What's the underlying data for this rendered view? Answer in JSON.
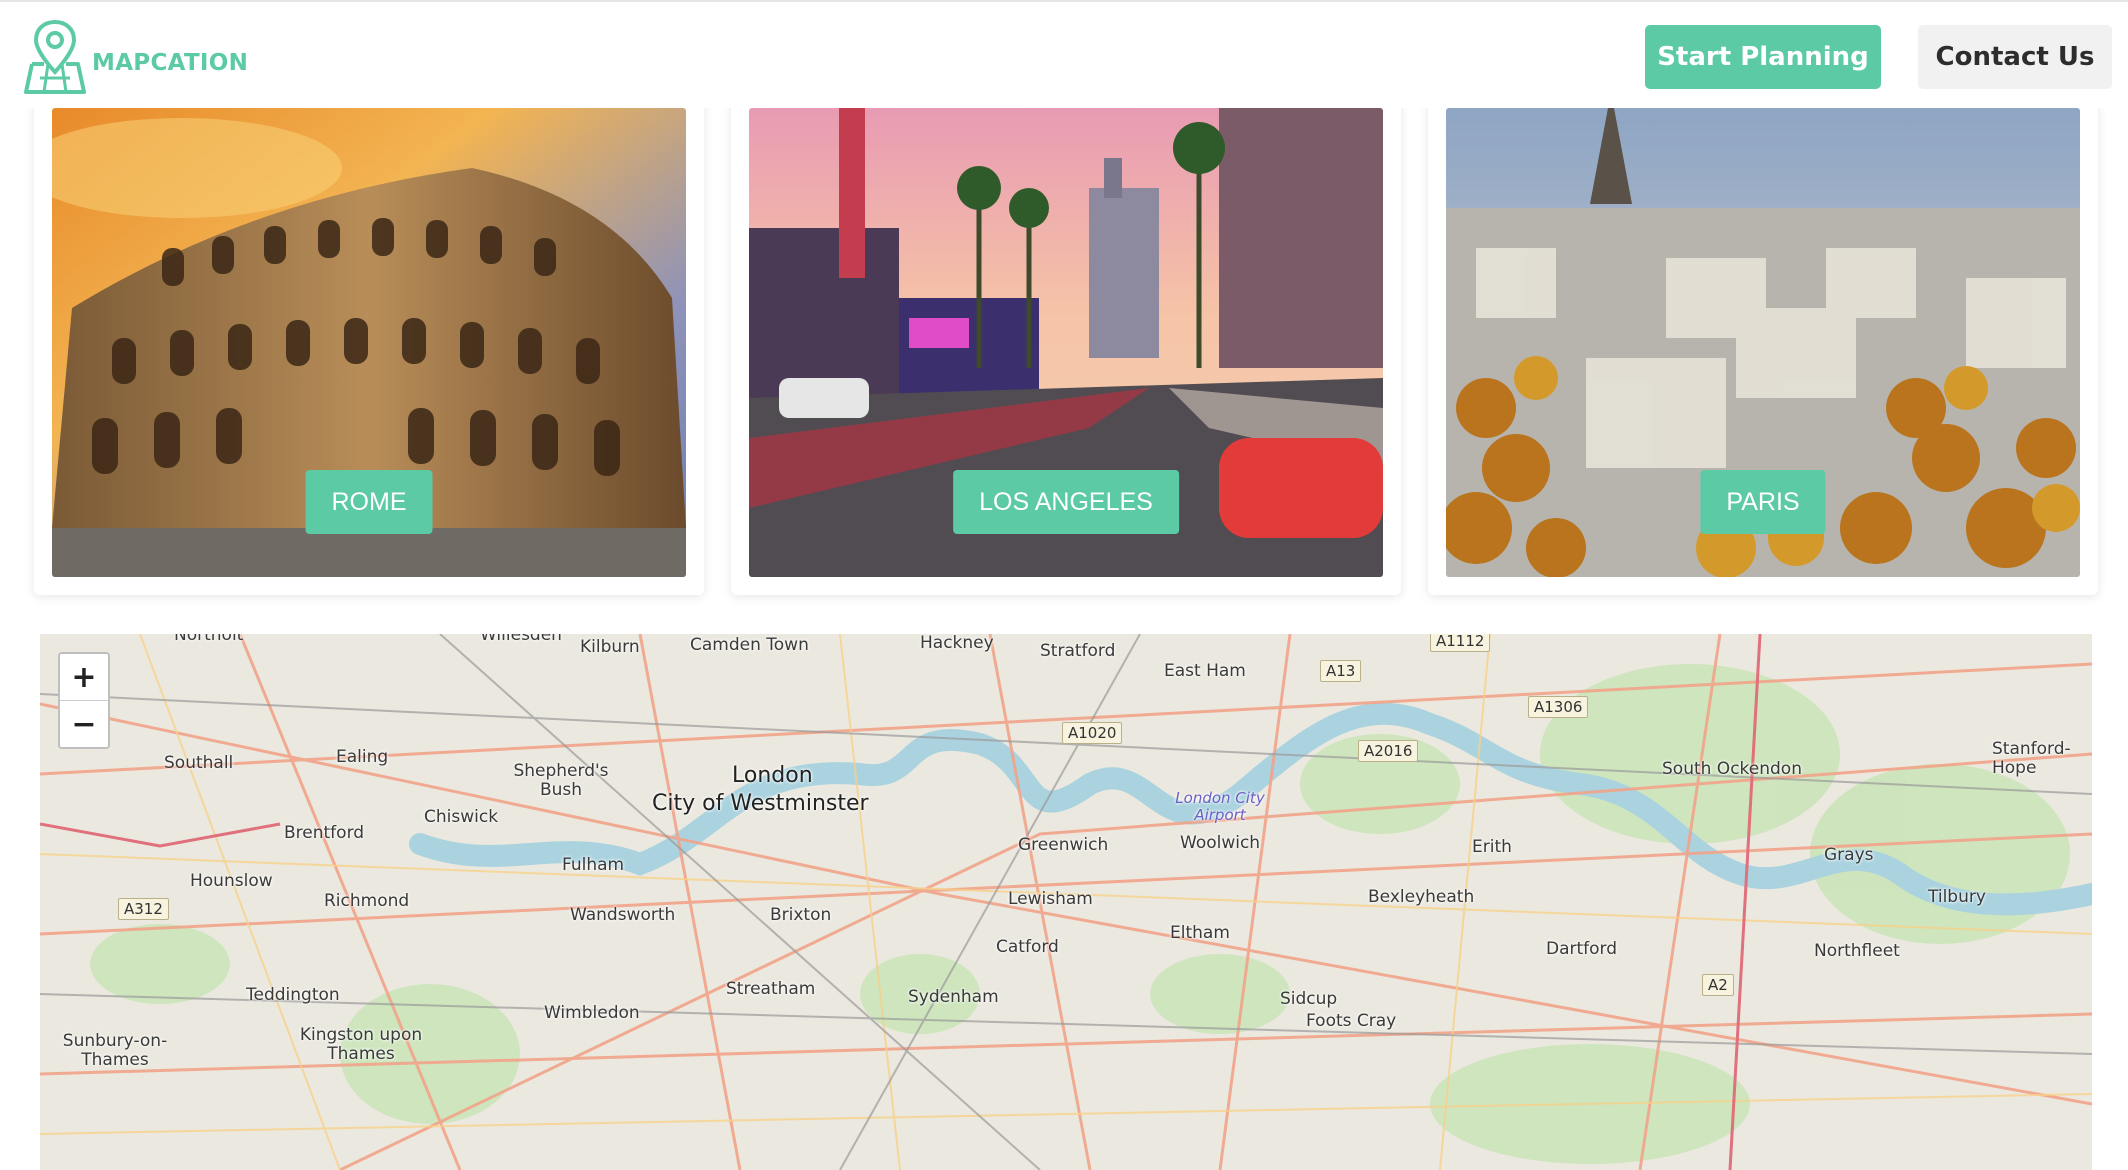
{
  "header": {
    "brand": "MAPCATION",
    "start_planning": "Start Planning",
    "contact_us": "Contact Us"
  },
  "cities": [
    {
      "label": "ROME"
    },
    {
      "label": "LOS ANGELES"
    },
    {
      "label": "PARIS"
    }
  ],
  "map": {
    "zoom_in": "+",
    "zoom_out": "−",
    "places": [
      "Kilburn",
      "Camden Town",
      "Hackney",
      "Stratford",
      "East Ham",
      "Southall",
      "Ealing",
      "Shepherd's Bush",
      "London",
      "City of Westminster",
      "Chiswick",
      "Brentford",
      "Fulham",
      "Hounslow",
      "Richmond",
      "Wandsworth",
      "Brixton",
      "Greenwich",
      "Woolwich",
      "Lewisham",
      "Eltham",
      "Catford",
      "Bexleyheath",
      "Erith",
      "South Ockendon",
      "Grays",
      "Tilbury",
      "Dartford",
      "Northfleet",
      "Stanford-Hope",
      "Teddington",
      "Wimbledon",
      "Streatham",
      "Sydenham",
      "Sidcup",
      "Foots Cray",
      "Kingston upon Thames",
      "Sunbury-on-Thames",
      "Willesden",
      "Northolt"
    ],
    "airport": "London City Airport",
    "roads": [
      "A1112",
      "A13",
      "A1306",
      "A1020",
      "A2016",
      "A312",
      "A2"
    ],
    "colors": {
      "accent": "#5dcaa6",
      "water": "#aad3df",
      "park": "#c8e6b4"
    }
  }
}
